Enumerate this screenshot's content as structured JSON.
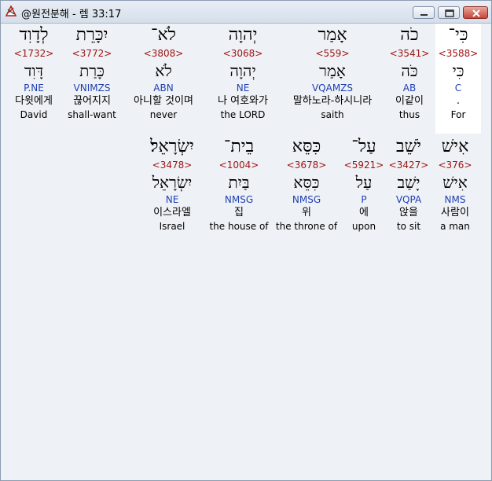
{
  "window": {
    "title": "@원전분해 - 렘 33:17",
    "icon": "app-icon"
  },
  "rows": [
    {
      "words": [
        {
          "heb": "כִּי־",
          "strong": "<3588>",
          "lemma": "כִּי",
          "parse": "C",
          "kor": ".",
          "eng": "For",
          "selected": true
        },
        {
          "heb": "כֹה",
          "strong": "<3541>",
          "lemma": "כֹּה",
          "parse": "AB",
          "kor": "이같이",
          "eng": "thus",
          "selected": false
        },
        {
          "heb": "אָמַר",
          "strong": "<559>",
          "lemma": "אָמַר",
          "parse": "VQAMZS",
          "kor": "말하노라-하시니라",
          "eng": "saith",
          "selected": false
        },
        {
          "heb": "יְהוָה",
          "strong": "<3068>",
          "lemma": "יְהוָה",
          "parse": "NE",
          "kor": "나 여호와가",
          "eng": "the LORD",
          "selected": false
        },
        {
          "heb": "לֹא־",
          "strong": "<3808>",
          "lemma": "לֹא",
          "parse": "ABN",
          "kor": "아니할 것이며",
          "eng": "never",
          "selected": false
        },
        {
          "heb": "יִכָּרֵת",
          "strong": "<3772>",
          "lemma": "כָּרַת",
          "parse": "VNIMZS",
          "kor": "끊어지지",
          "eng": "shall-want",
          "selected": false
        },
        {
          "heb": "לְדָוִד",
          "strong": "<1732>",
          "lemma": "דָּוִד",
          "parse": "P.NE",
          "kor": "다윗에게",
          "eng": "David",
          "selected": false
        }
      ]
    },
    {
      "words": [
        {
          "heb": "אִישׁ",
          "strong": "<376>",
          "lemma": "אִישׁ",
          "parse": "NMS",
          "kor": "사람이",
          "eng": "a man",
          "selected": false
        },
        {
          "heb": "יֹשֵׁב",
          "strong": "<3427>",
          "lemma": "יָשַׁב",
          "parse": "VQPA",
          "kor": "앉을",
          "eng": "to sit",
          "selected": false
        },
        {
          "heb": "עַל־",
          "strong": "<5921>",
          "lemma": "עַל",
          "parse": "P",
          "kor": "에",
          "eng": "upon",
          "selected": false
        },
        {
          "heb": "כִּסֵּא",
          "strong": "<3678>",
          "lemma": "כִּסֵּא",
          "parse": "NMSG",
          "kor": "위",
          "eng": "the throne of",
          "selected": false
        },
        {
          "heb": "בֵית־",
          "strong": "<1004>",
          "lemma": "בַּיִת",
          "parse": "NMSG",
          "kor": "집",
          "eng": "the house of",
          "selected": false
        },
        {
          "heb": "יִשְׂרָאֵל׃",
          "strong": "<3478>",
          "lemma": "יִשְׂרָאֵל",
          "parse": "NE",
          "kor": "이스라엘",
          "eng": "Israel",
          "selected": false
        }
      ]
    }
  ]
}
